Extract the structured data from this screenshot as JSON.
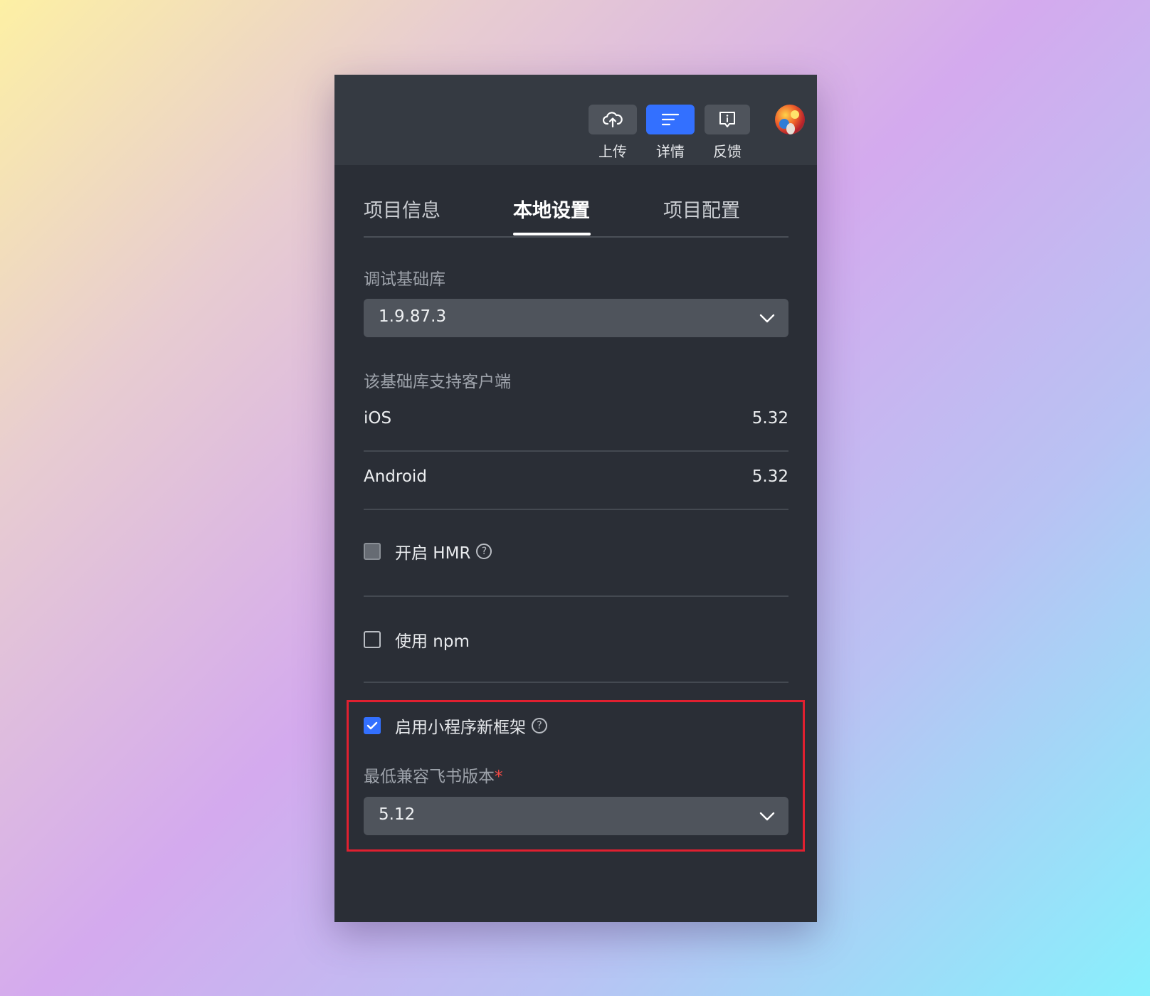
{
  "toolbar": {
    "buttons": [
      {
        "label": "上传",
        "icon": "cloud-upload-icon"
      },
      {
        "label": "详情",
        "icon": "details-list-icon",
        "active": true
      },
      {
        "label": "反馈",
        "icon": "feedback-icon"
      }
    ],
    "avatar": "user-avatar"
  },
  "tabs": [
    {
      "label": "项目信息"
    },
    {
      "label": "本地设置",
      "active": true
    },
    {
      "label": "项目配置"
    }
  ],
  "debug_lib": {
    "label": "调试基础库",
    "value": "1.9.87.3"
  },
  "supported_clients": {
    "label": "该基础库支持客户端",
    "rows": [
      {
        "name": "iOS",
        "version": "5.32"
      },
      {
        "name": "Android",
        "version": "5.32"
      }
    ]
  },
  "options": {
    "hmr": {
      "label": "开启 HMR",
      "checked": false
    },
    "npm": {
      "label": "使用 npm",
      "checked": false
    },
    "new_framework": {
      "label": "启用小程序新框架",
      "checked": true
    }
  },
  "min_version": {
    "label": "最低兼容飞书版本",
    "required_mark": "*",
    "value": "5.12"
  },
  "colors": {
    "accent": "#3370ff",
    "panel_bg": "#2a2e36",
    "toolbar_bg": "#353a42",
    "highlight": "#e02030",
    "required": "#f54a45"
  }
}
